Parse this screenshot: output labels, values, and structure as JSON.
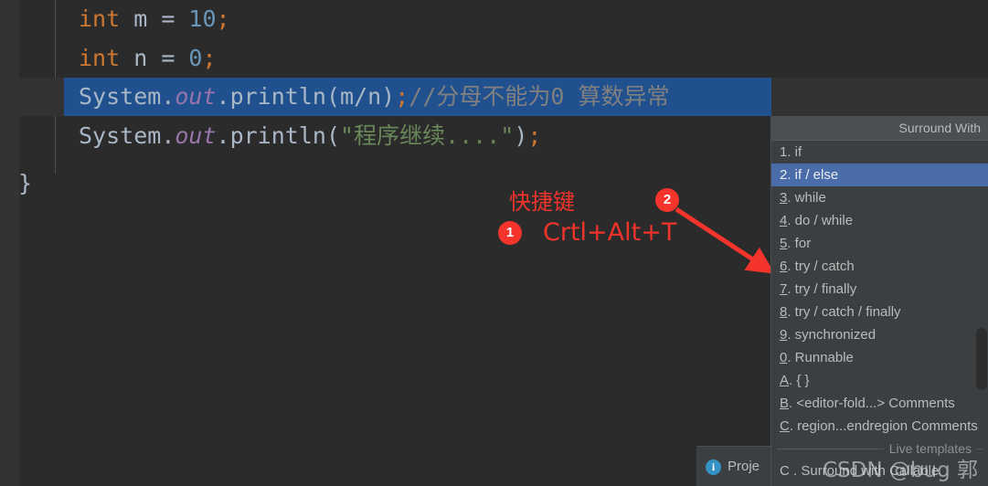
{
  "editor": {
    "lines": [
      {
        "id": "line-1",
        "indent": "    ",
        "tokens": [
          {
            "cls": "kw",
            "t": "int"
          },
          {
            "cls": "txt",
            "t": " m "
          },
          {
            "cls": "txt",
            "t": "= "
          },
          {
            "cls": "num",
            "t": "10"
          },
          {
            "cls": "pun",
            "t": ";"
          }
        ],
        "plain": "    int m = 10;"
      },
      {
        "id": "line-2",
        "plain": "    int n = 0;"
      },
      {
        "id": "line-3",
        "plain": "    System.out.println(m/n);//分母不能为0 算数异常",
        "selected": true,
        "comment": "//分母不能为0 算数异常"
      },
      {
        "id": "line-4",
        "plain": "    System.out.println(\"程序继续....\");",
        "string": "\"程序继续....\""
      },
      {
        "id": "line-5",
        "plain": "}"
      }
    ],
    "code": {
      "kw_int": "int",
      "var_m": " m ",
      "eq": "= ",
      "num_10": "10",
      "semi": ";",
      "var_n": " n ",
      "num_0": "0",
      "sys": "System",
      "dot": ".",
      "out": "out",
      "println": ".println",
      "paren_open": "(",
      "mn_expr": "m/n",
      "paren_close": ")",
      "comment_text": "//分母不能为0 算数异常",
      "str_text": "\"程序继续....\"",
      "close_brace": "}"
    }
  },
  "annotations": {
    "title": "快捷键",
    "shortcut": "Crtl+Alt+T",
    "badge_one": "1",
    "badge_two": "2",
    "accent_color": "#f5342c"
  },
  "popup": {
    "header": "Surround With",
    "items": [
      {
        "mn": "1",
        "label": ". if",
        "selected": false,
        "underline": false
      },
      {
        "mn": "2",
        "label": ". if / else",
        "selected": true,
        "underline": false
      },
      {
        "mn": "3",
        "label": ". while",
        "selected": false,
        "underline": true
      },
      {
        "mn": "4",
        "label": ". do / while",
        "selected": false,
        "underline": true
      },
      {
        "mn": "5",
        "label": ". for",
        "selected": false,
        "underline": true
      },
      {
        "mn": "6",
        "label": ". try / catch",
        "selected": false,
        "underline": true
      },
      {
        "mn": "7",
        "label": ". try / finally",
        "selected": false,
        "underline": true
      },
      {
        "mn": "8",
        "label": ". try / catch / finally",
        "selected": false,
        "underline": true
      },
      {
        "mn": "9",
        "label": ". synchronized",
        "selected": false,
        "underline": true
      },
      {
        "mn": "0",
        "label": ". Runnable",
        "selected": false,
        "underline": true
      },
      {
        "mn": "A",
        "label": ". { }",
        "selected": false,
        "underline": true
      },
      {
        "mn": "B",
        "label": ". <editor-fold...> Comments",
        "selected": false,
        "underline": true
      },
      {
        "mn": "C",
        "label": ". region...endregion Comments",
        "selected": false,
        "underline": true
      }
    ],
    "separator_label": "Live templates",
    "template_item": {
      "mn": "C",
      "label": " . Surround with Callable"
    },
    "selected_color": "#4a6daa"
  },
  "statusbar": {
    "info_icon": "info-icon",
    "project_label": "Proje"
  },
  "watermark": {
    "text": "CSDN @bug 郭"
  }
}
